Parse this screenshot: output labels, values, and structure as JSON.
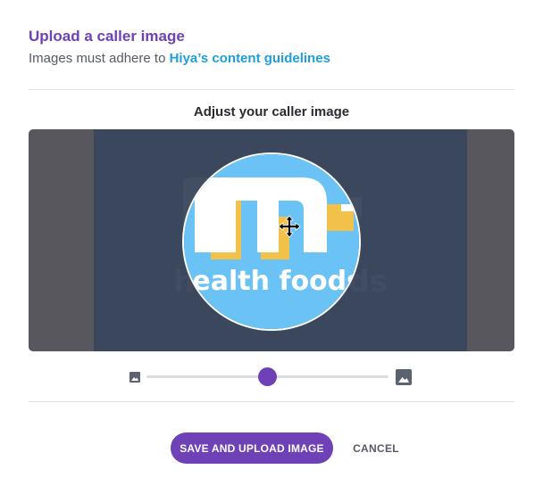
{
  "header": {
    "title": "Upload a caller image",
    "subtitle_prefix": "Images must adhere to ",
    "guidelines_link": "Hiya’s content guidelines"
  },
  "editor": {
    "heading": "Adjust your caller image",
    "image_logo_text": "health foods",
    "zoom_level": 0.5
  },
  "actions": {
    "save_label": "SAVE AND UPLOAD IMAGE",
    "cancel_label": "CANCEL"
  },
  "icons": {
    "zoom_out": "image-small-icon",
    "zoom_in": "image-large-icon",
    "move": "move-cursor-icon"
  },
  "colors": {
    "accent": "#6e41b6",
    "link": "#1e9fd8",
    "logo_bg": "#6bc2f5",
    "logo_yellow": "#f2c14a"
  }
}
